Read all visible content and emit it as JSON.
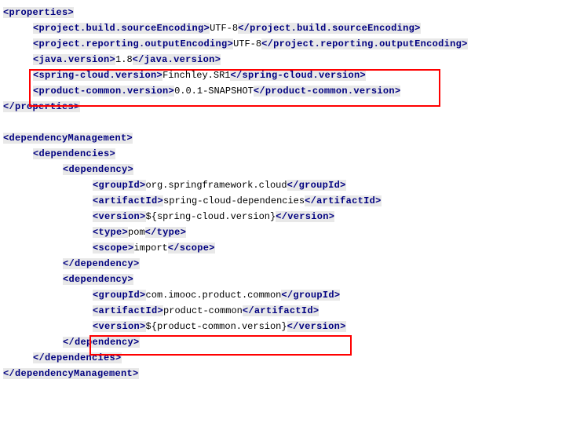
{
  "code": {
    "lt": "<",
    "gt": ">",
    "lts": "</",
    "properties_open": "properties",
    "properties_close": "properties",
    "sourceEncoding": {
      "tag": "project.build.sourceEncoding",
      "val": "UTF-8"
    },
    "outputEncoding": {
      "tag": "project.reporting.outputEncoding",
      "val": "UTF-8"
    },
    "javaVersion": {
      "tag": "java.version",
      "val": "1.8"
    },
    "springCloud": {
      "tag": "spring-cloud.version",
      "val": "Finchley.SR1"
    },
    "productCommon": {
      "tag": "product-common.version",
      "val": "0.0.1-SNAPSHOT"
    },
    "depMgmt_open": "dependencyManagement",
    "depMgmt_close": "dependencyManagement",
    "deps_open": "dependencies",
    "deps_close": "dependencies",
    "dep_open": "dependency",
    "dep_close": "dependency",
    "dep1": {
      "groupId": {
        "tag": "groupId",
        "val": "org.springframework.cloud"
      },
      "artifactId": {
        "tag": "artifactId",
        "val": "spring-cloud-dependencies"
      },
      "version": {
        "tag": "version",
        "val": "${spring-cloud.version}"
      },
      "type": {
        "tag": "type",
        "val": "pom"
      },
      "scope": {
        "tag": "scope",
        "val": "import"
      }
    },
    "dep2": {
      "groupId": {
        "tag": "groupId",
        "val": "com.imooc.product.common"
      },
      "artifactId": {
        "tag": "artifactId",
        "val": "product-common"
      },
      "version": {
        "tag": "version",
        "val": "${product-common.version}"
      }
    }
  }
}
